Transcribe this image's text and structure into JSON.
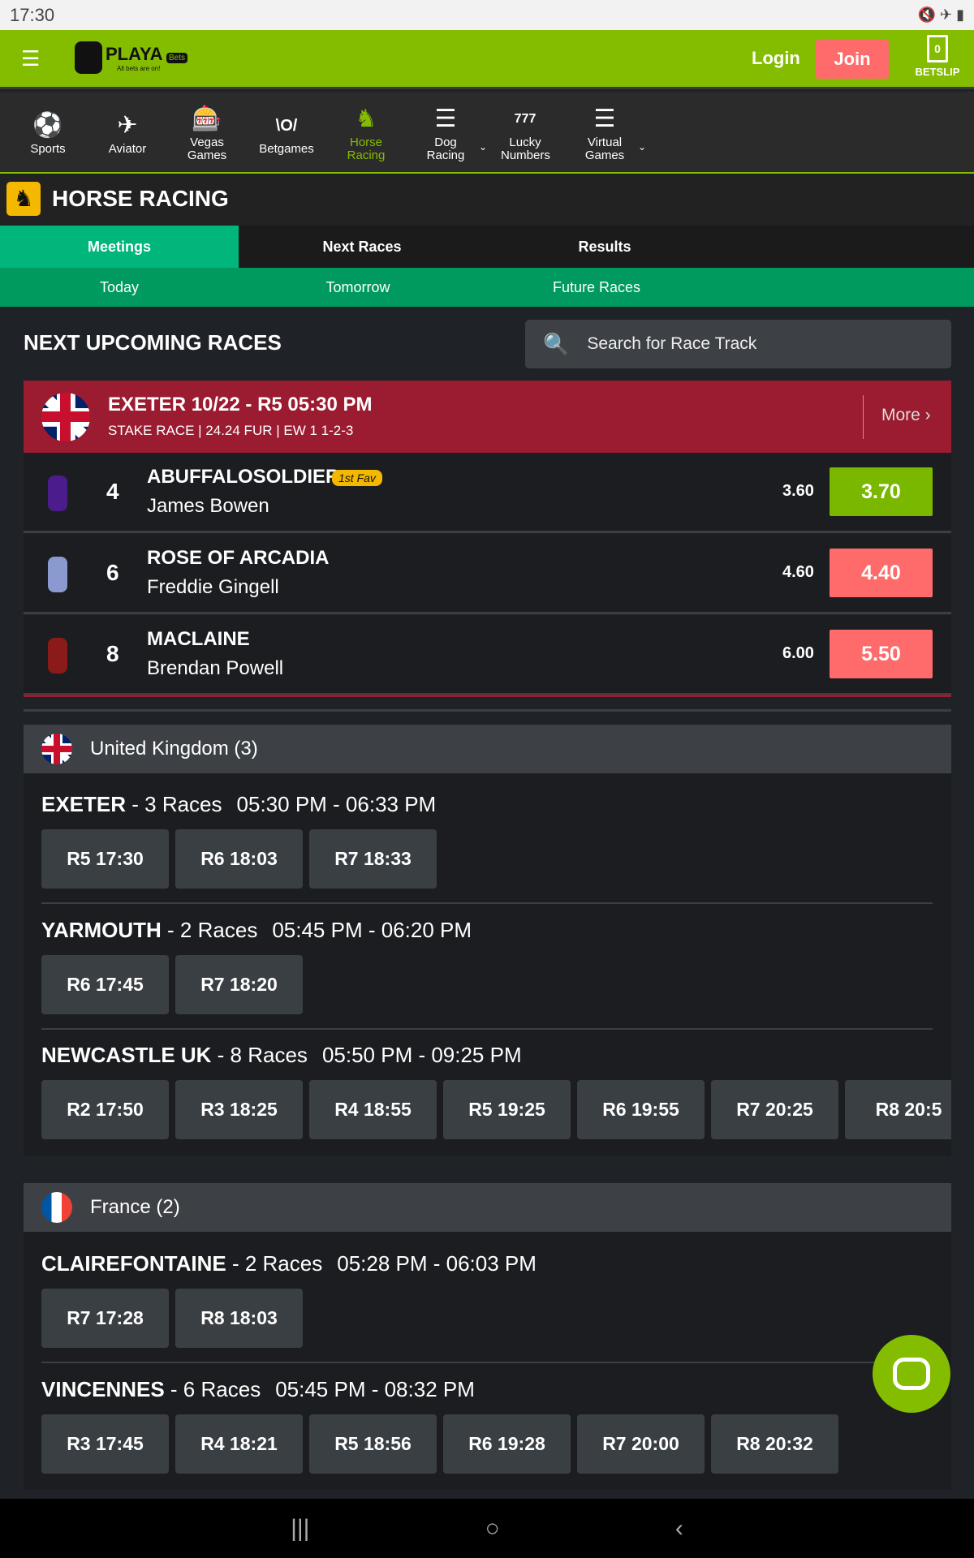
{
  "status": {
    "time": "17:30"
  },
  "header": {
    "logo_text": "PLAYA",
    "logo_badge": "Bets",
    "logo_tagline": "All bets are on!",
    "login": "Login",
    "join": "Join",
    "betslip_count": "0",
    "betslip_label": "BETSLIP"
  },
  "nav": [
    {
      "label": "Sports",
      "icon": "⚽"
    },
    {
      "label": "Aviator",
      "icon": "✈"
    },
    {
      "label": "Vegas Games",
      "icon": "🎰"
    },
    {
      "label": "Betgames",
      "icon": "\\O/"
    },
    {
      "label": "Horse Racing",
      "icon": "♞"
    },
    {
      "label": "Dog Racing",
      "icon": "☰"
    },
    {
      "label": "Lucky Numbers",
      "icon": "777"
    },
    {
      "label": "Virtual Games",
      "icon": "☰"
    }
  ],
  "page_title": "HORSE RACING",
  "tabs": [
    "Meetings",
    "Next Races",
    "Results"
  ],
  "subtabs": [
    "Today",
    "Tomorrow",
    "Future Races"
  ],
  "upcoming": {
    "title": "NEXT UPCOMING RACES",
    "search_placeholder": "Search for Race Track"
  },
  "featured": {
    "title": "EXETER 10/22 - R5 05:30 PM",
    "subtitle": "STAKE RACE | 24.24 FUR | EW 1 1-2-3",
    "more": "More ›",
    "runners": [
      {
        "number": "4",
        "horse": "ABUFFALOSOLDIER",
        "badge": "1st Fav",
        "jockey": "James Bowen",
        "prev_odds": "3.60",
        "odds": "3.70",
        "color": "#7ab800",
        "silk": "#4b1d8c"
      },
      {
        "number": "6",
        "horse": "ROSE OF ARCADIA",
        "badge": "",
        "jockey": "Freddie Gingell",
        "prev_odds": "4.60",
        "odds": "4.40",
        "color": "#ff6b6b",
        "silk": "#8a9ad0"
      },
      {
        "number": "8",
        "horse": "MACLAINE",
        "badge": "",
        "jockey": "Brendan Powell",
        "prev_odds": "6.00",
        "odds": "5.50",
        "color": "#ff6b6b",
        "silk": "#8b1a1a"
      }
    ]
  },
  "countries": [
    {
      "name": "United Kingdom (3)",
      "meetings": [
        {
          "name": "EXETER",
          "count": " - 3 Races",
          "times": "05:30 PM - 06:33 PM",
          "races": [
            "R5 17:30",
            "R6 18:03",
            "R7 18:33"
          ]
        },
        {
          "name": "YARMOUTH",
          "count": " - 2 Races",
          "times": "05:45 PM - 06:20 PM",
          "races": [
            "R6 17:45",
            "R7 18:20"
          ]
        },
        {
          "name": "NEWCASTLE UK",
          "count": " - 8 Races",
          "times": "05:50 PM - 09:25 PM",
          "races": [
            "R2 17:50",
            "R3 18:25",
            "R4 18:55",
            "R5 19:25",
            "R6 19:55",
            "R7 20:25",
            "R8 20:5"
          ]
        }
      ]
    },
    {
      "name": "France (2)",
      "meetings": [
        {
          "name": "CLAIREFONTAINE",
          "count": " - 2 Races",
          "times": "05:28 PM - 06:03 PM",
          "races": [
            "R7 17:28",
            "R8 18:03"
          ]
        },
        {
          "name": "VINCENNES",
          "count": " - 6 Races",
          "times": "05:45 PM - 08:32 PM",
          "races": [
            "R3 17:45",
            "R4 18:21",
            "R5 18:56",
            "R6 19:28",
            "R7 20:00",
            "R8 20:32"
          ]
        }
      ]
    }
  ]
}
